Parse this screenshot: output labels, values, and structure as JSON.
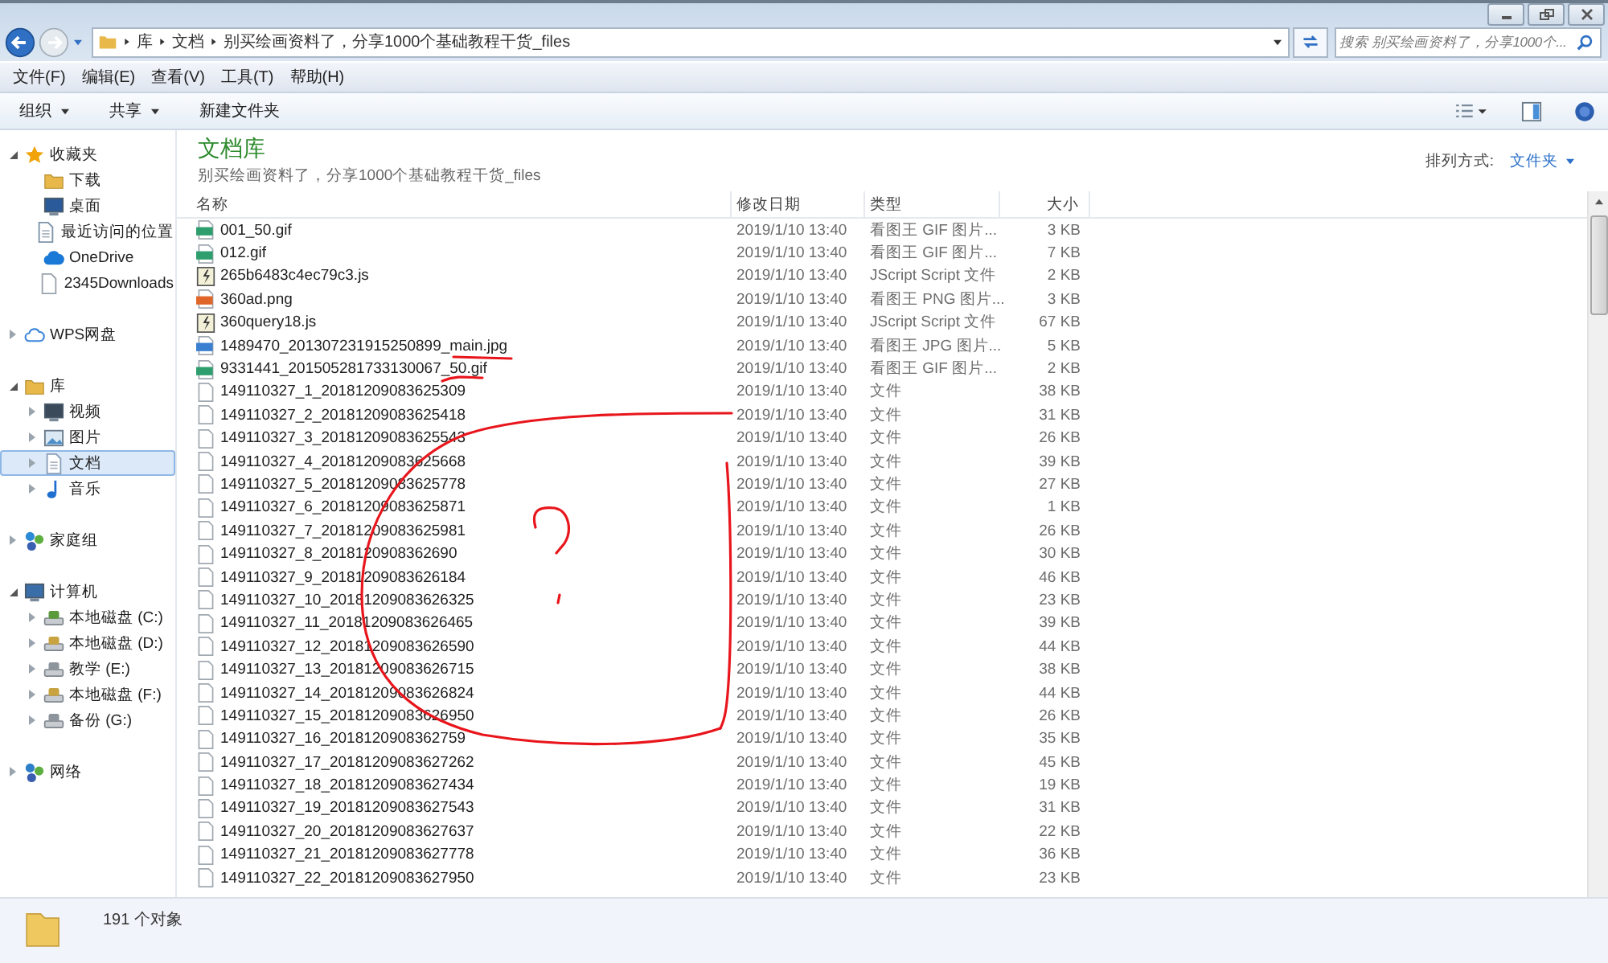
{
  "address_bar": {
    "breadcrumb": [
      "库",
      "文档",
      "别买绘画资料了，分享1000个基础教程干货_files"
    ]
  },
  "search": {
    "placeholder": "搜索 别买绘画资料了，分享1000个..."
  },
  "menu": [
    "文件(F)",
    "编辑(E)",
    "查看(V)",
    "工具(T)",
    "帮助(H)"
  ],
  "toolbar": [
    {
      "label": "组织",
      "dropdown": true
    },
    {
      "label": "共享",
      "dropdown": true
    },
    {
      "label": "新建文件夹",
      "dropdown": false
    }
  ],
  "sidebar": {
    "groups": [
      {
        "label": "收藏夹",
        "kind": "star",
        "expanded": true,
        "selected": false,
        "children": [
          {
            "label": "下载",
            "kind": "download",
            "selected": false
          },
          {
            "label": "桌面",
            "kind": "desktop",
            "selected": false
          },
          {
            "label": "最近访问的位置",
            "kind": "recent",
            "selected": false
          },
          {
            "label": "OneDrive",
            "kind": "cloud",
            "selected": false
          },
          {
            "label": "2345Downloads",
            "kind": "file",
            "selected": false
          }
        ]
      },
      {
        "label": "WPS网盘",
        "kind": "cloud-outline",
        "expanded": false,
        "selected": false
      },
      {
        "label": "库",
        "kind": "library",
        "expanded": true,
        "selected": false,
        "children": [
          {
            "label": "视频",
            "kind": "video",
            "expanded": false,
            "selected": false
          },
          {
            "label": "图片",
            "kind": "picture",
            "expanded": false,
            "selected": false
          },
          {
            "label": "文档",
            "kind": "document",
            "expanded": false,
            "selected": true
          },
          {
            "label": "音乐",
            "kind": "music",
            "expanded": false,
            "selected": false
          }
        ]
      },
      {
        "label": "家庭组",
        "kind": "homegroup",
        "expanded": false,
        "selected": false
      },
      {
        "label": "计算机",
        "kind": "computer",
        "expanded": true,
        "selected": false,
        "children": [
          {
            "label": "本地磁盘 (C:)",
            "kind": "drive-system",
            "expanded": false,
            "selected": false
          },
          {
            "label": "本地磁盘 (D:)",
            "kind": "drive-shared",
            "expanded": false,
            "selected": false
          },
          {
            "label": "教学 (E:)",
            "kind": "drive",
            "expanded": false,
            "selected": false
          },
          {
            "label": "本地磁盘 (F:)",
            "kind": "drive-shared",
            "expanded": false,
            "selected": false
          },
          {
            "label": "备份 (G:)",
            "kind": "drive",
            "expanded": false,
            "selected": false
          }
        ]
      },
      {
        "label": "网络",
        "kind": "network",
        "expanded": false,
        "selected": false
      }
    ]
  },
  "library": {
    "title": "文档库",
    "subtitle": "别买绘画资料了，分享1000个基础教程干货_files",
    "arrange_label": "排列方式:",
    "arrange_value": "文件夹"
  },
  "table": {
    "columns": [
      "名称",
      "修改日期",
      "类型",
      "大小"
    ],
    "rows": [
      {
        "kind": "gif",
        "name": "001_50.gif",
        "modified": "2019/1/10 13:40",
        "type": "看图王 GIF 图片...",
        "size": "3 KB"
      },
      {
        "kind": "gif",
        "name": "012.gif",
        "modified": "2019/1/10 13:40",
        "type": "看图王 GIF 图片...",
        "size": "7 KB"
      },
      {
        "kind": "js",
        "name": "265b6483c4ec79c3.js",
        "modified": "2019/1/10 13:40",
        "type": "JScript Script 文件",
        "size": "2 KB"
      },
      {
        "kind": "png",
        "name": "360ad.png",
        "modified": "2019/1/10 13:40",
        "type": "看图王 PNG 图片...",
        "size": "3 KB"
      },
      {
        "kind": "js",
        "name": "360query18.js",
        "modified": "2019/1/10 13:40",
        "type": "JScript Script 文件",
        "size": "67 KB"
      },
      {
        "kind": "jpg",
        "name": "1489470_201307231915250899_main.jpg",
        "modified": "2019/1/10 13:40",
        "type": "看图王 JPG 图片...",
        "size": "5 KB"
      },
      {
        "kind": "gif",
        "name": "9331441_201505281733130067_50.gif",
        "modified": "2019/1/10 13:40",
        "type": "看图王 GIF 图片...",
        "size": "2 KB"
      },
      {
        "kind": "file",
        "name": "149110327_1_20181209083625309",
        "modified": "2019/1/10 13:40",
        "type": "文件",
        "size": "38 KB"
      },
      {
        "kind": "file",
        "name": "149110327_2_20181209083625418",
        "modified": "2019/1/10 13:40",
        "type": "文件",
        "size": "31 KB"
      },
      {
        "kind": "file",
        "name": "149110327_3_20181209083625543",
        "modified": "2019/1/10 13:40",
        "type": "文件",
        "size": "26 KB"
      },
      {
        "kind": "file",
        "name": "149110327_4_20181209083625668",
        "modified": "2019/1/10 13:40",
        "type": "文件",
        "size": "39 KB"
      },
      {
        "kind": "file",
        "name": "149110327_5_20181209083625778",
        "modified": "2019/1/10 13:40",
        "type": "文件",
        "size": "27 KB"
      },
      {
        "kind": "file",
        "name": "149110327_6_20181209083625871",
        "modified": "2019/1/10 13:40",
        "type": "文件",
        "size": "1 KB"
      },
      {
        "kind": "file",
        "name": "149110327_7_20181209083625981",
        "modified": "2019/1/10 13:40",
        "type": "文件",
        "size": "26 KB"
      },
      {
        "kind": "file",
        "name": "149110327_8_2018120908362690",
        "modified": "2019/1/10 13:40",
        "type": "文件",
        "size": "30 KB"
      },
      {
        "kind": "file",
        "name": "149110327_9_20181209083626184",
        "modified": "2019/1/10 13:40",
        "type": "文件",
        "size": "46 KB"
      },
      {
        "kind": "file",
        "name": "149110327_10_20181209083626325",
        "modified": "2019/1/10 13:40",
        "type": "文件",
        "size": "23 KB"
      },
      {
        "kind": "file",
        "name": "149110327_11_20181209083626465",
        "modified": "2019/1/10 13:40",
        "type": "文件",
        "size": "39 KB"
      },
      {
        "kind": "file",
        "name": "149110327_12_20181209083626590",
        "modified": "2019/1/10 13:40",
        "type": "文件",
        "size": "44 KB"
      },
      {
        "kind": "file",
        "name": "149110327_13_20181209083626715",
        "modified": "2019/1/10 13:40",
        "type": "文件",
        "size": "38 KB"
      },
      {
        "kind": "file",
        "name": "149110327_14_20181209083626824",
        "modified": "2019/1/10 13:40",
        "type": "文件",
        "size": "44 KB"
      },
      {
        "kind": "file",
        "name": "149110327_15_20181209083626950",
        "modified": "2019/1/10 13:40",
        "type": "文件",
        "size": "26 KB"
      },
      {
        "kind": "file",
        "name": "149110327_16_2018120908362759",
        "modified": "2019/1/10 13:40",
        "type": "文件",
        "size": "35 KB"
      },
      {
        "kind": "file",
        "name": "149110327_17_20181209083627262",
        "modified": "2019/1/10 13:40",
        "type": "文件",
        "size": "45 KB"
      },
      {
        "kind": "file",
        "name": "149110327_18_20181209083627434",
        "modified": "2019/1/10 13:40",
        "type": "文件",
        "size": "19 KB"
      },
      {
        "kind": "file",
        "name": "149110327_19_20181209083627543",
        "modified": "2019/1/10 13:40",
        "type": "文件",
        "size": "31 KB"
      },
      {
        "kind": "file",
        "name": "149110327_20_20181209083627637",
        "modified": "2019/1/10 13:40",
        "type": "文件",
        "size": "22 KB"
      },
      {
        "kind": "file",
        "name": "149110327_21_20181209083627778",
        "modified": "2019/1/10 13:40",
        "type": "文件",
        "size": "36 KB"
      },
      {
        "kind": "file",
        "name": "149110327_22_20181209083627950",
        "modified": "2019/1/10 13:40",
        "type": "文件",
        "size": "23 KB"
      }
    ]
  },
  "status_bar": {
    "count": "191 个对象"
  }
}
